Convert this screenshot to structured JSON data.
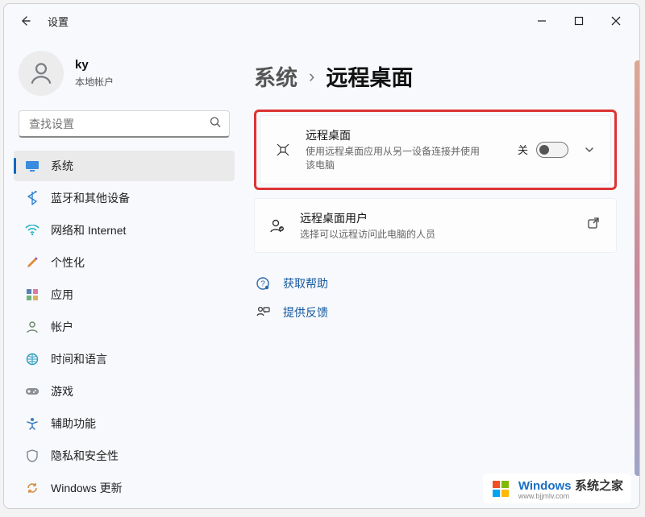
{
  "window": {
    "title": "设置"
  },
  "user": {
    "name": "ky",
    "type": "本地帐户"
  },
  "search": {
    "placeholder": "查找设置"
  },
  "nav": {
    "items": [
      {
        "label": "系统"
      },
      {
        "label": "蓝牙和其他设备"
      },
      {
        "label": "网络和 Internet"
      },
      {
        "label": "个性化"
      },
      {
        "label": "应用"
      },
      {
        "label": "帐户"
      },
      {
        "label": "时间和语言"
      },
      {
        "label": "游戏"
      },
      {
        "label": "辅助功能"
      },
      {
        "label": "隐私和安全性"
      },
      {
        "label": "Windows 更新"
      }
    ]
  },
  "breadcrumb": {
    "parent": "系统",
    "sep": "›",
    "current": "远程桌面"
  },
  "cards": {
    "remote": {
      "title": "远程桌面",
      "sub": "使用远程桌面应用从另一设备连接并使用该电脑",
      "toggle_label": "关"
    },
    "users": {
      "title": "远程桌面用户",
      "sub": "选择可以远程访问此电脑的人员"
    }
  },
  "links": {
    "help": "获取帮助",
    "feedback": "提供反馈"
  },
  "watermark": {
    "brand1": "Windows",
    "brand2": "系统之家",
    "url": "www.bjjmlv.com"
  }
}
